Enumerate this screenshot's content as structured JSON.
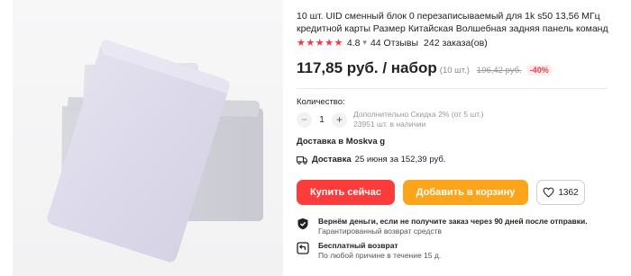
{
  "product": {
    "title": "10 шт. UID сменный блок 0 перезаписываемый для 1k s50 13,56 МГц кредитной карты Размер Китайская Волшебная задняя панель команд",
    "rating": "4.8",
    "stars": "★★★★★",
    "rating_separator": "▾",
    "reviews": "44 Отзывы",
    "orders": "242 заказа(ов)"
  },
  "price": {
    "current": "117,85 руб. / набор",
    "quantity_note": "(10 шт.)",
    "old": "196,42 руб.",
    "discount": "-40%"
  },
  "quantity": {
    "label": "Количество:",
    "value": "1",
    "minus": "−",
    "plus": "+",
    "discount_note": "Дополнительно Скидка 2% (от 5 шт.)",
    "stock": "23951 шт. в наличии"
  },
  "delivery": {
    "to": "Доставка в Moskva g",
    "label": "Доставка",
    "date": "25 июня за 152,39 руб.",
    "icon": "truck-icon"
  },
  "actions": {
    "buy": "Купить сейчас",
    "cart": "Добавить в корзину",
    "wishlist_count": "1362"
  },
  "guarantees": [
    {
      "title": "Вернём деньги, если не получите заказ через 90 дней после отправки.",
      "subtitle": "Гарантированный возврат средств",
      "icon": "shield-icon"
    },
    {
      "title": "Бесплатный возврат",
      "subtitle": "По любой причине в течение 15 д.",
      "icon": "return-icon"
    }
  ],
  "colors": {
    "buy": "#fc3b3b",
    "cart": "#fda51a",
    "accent_red": "#f03846"
  }
}
